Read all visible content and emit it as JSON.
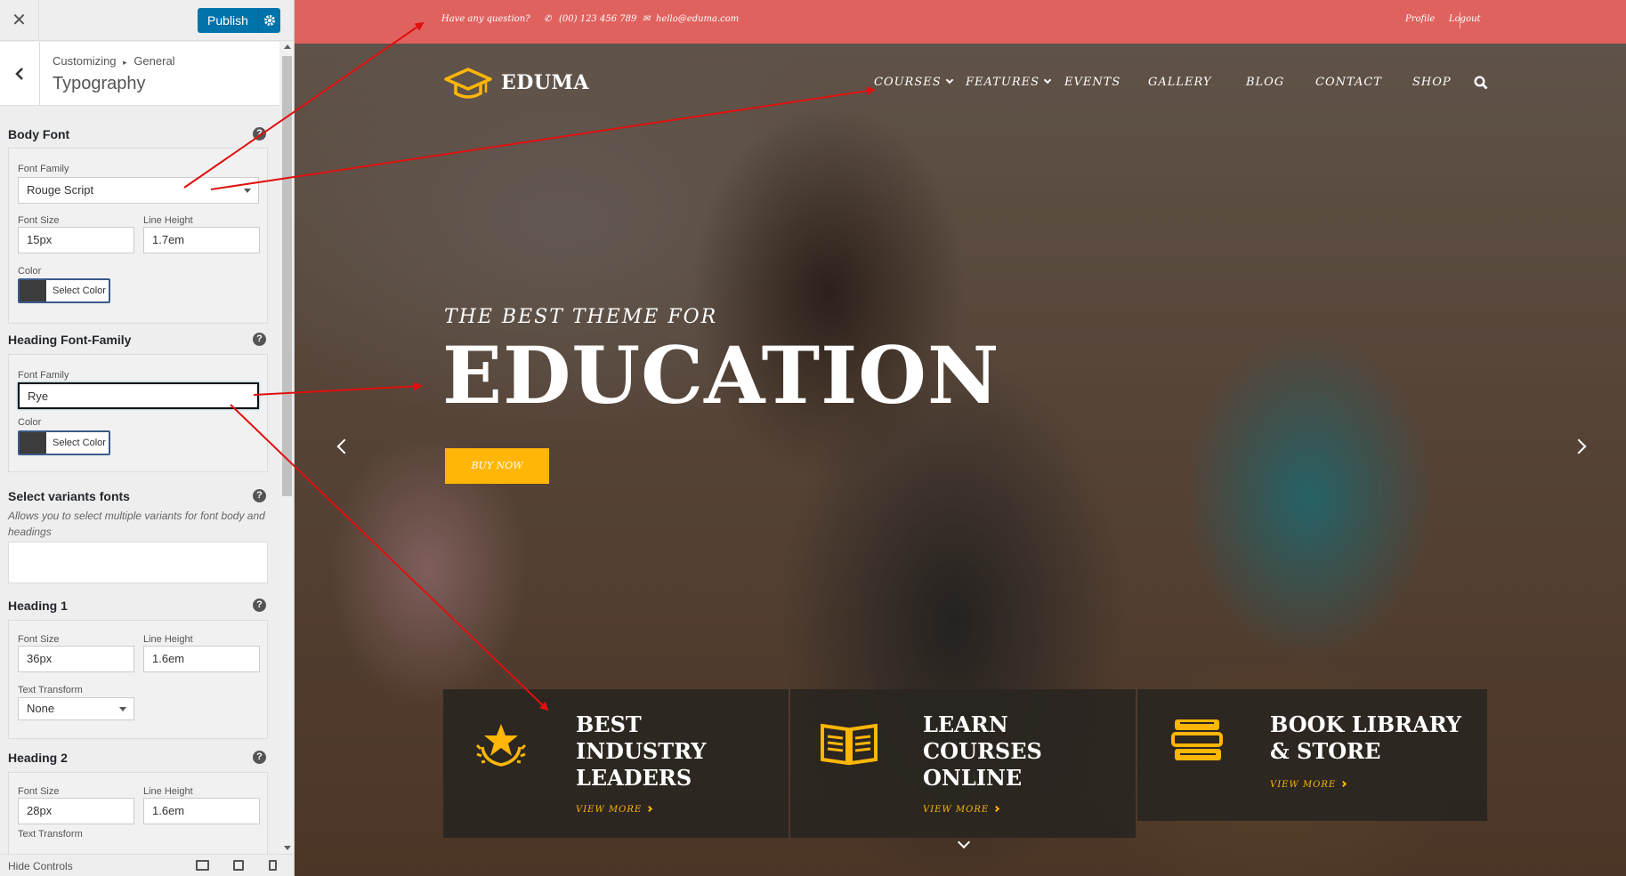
{
  "customizer": {
    "close_icon": "close-icon",
    "publish_label": "Publish",
    "crumbs": [
      "Customizing",
      "General"
    ],
    "crumb_separator": "▸",
    "section_title": "Typography",
    "body_font": {
      "title": "Body Font",
      "font_family_label": "Font Family",
      "font_family_value": "Rouge Script",
      "font_size_label": "Font Size",
      "font_size_value": "15px",
      "line_height_label": "Line Height",
      "line_height_value": "1.7em",
      "color_label": "Color",
      "color_button": "Select Color"
    },
    "heading_font": {
      "title": "Heading Font-Family",
      "font_family_label": "Font Family",
      "font_family_value": "Rye",
      "color_label": "Color",
      "color_button": "Select Color"
    },
    "variants": {
      "title": "Select variants fonts",
      "description": "Allows you to select multiple variants for font body and headings"
    },
    "heading1": {
      "title": "Heading 1",
      "font_size_label": "Font Size",
      "font_size_value": "36px",
      "line_height_label": "Line Height",
      "line_height_value": "1.6em",
      "text_transform_label": "Text Transform",
      "text_transform_value": "None"
    },
    "heading2": {
      "title": "Heading 2",
      "font_size_label": "Font Size",
      "font_size_value": "28px",
      "line_height_label": "Line Height",
      "line_height_value": "1.6em",
      "text_transform_label": "Text Transform"
    },
    "help_glyph": "?",
    "footer": {
      "hide_controls": "Hide Controls"
    }
  },
  "site": {
    "topbar": {
      "question": "Have any question?",
      "phone": "(00) 123 456 789",
      "email": "hello@eduma.com",
      "profile": "Profile",
      "logout": "Logout"
    },
    "logo": "EDUMA",
    "nav": [
      "COURSES",
      "FEATURES",
      "EVENTS",
      "GALLERY",
      "BLOG",
      "CONTACT",
      "SHOP"
    ],
    "hero": {
      "subtitle": "THE BEST THEME FOR",
      "title": "EDUCATION",
      "button": "BUY NOW"
    },
    "features": [
      {
        "icon": "medal-star-icon",
        "title_lines": [
          "BEST",
          "INDUSTRY",
          "LEADERS"
        ],
        "more": "VIEW MORE"
      },
      {
        "icon": "open-book-icon",
        "title_lines": [
          "LEARN",
          "COURSES",
          "ONLINE"
        ],
        "more": "VIEW MORE"
      },
      {
        "icon": "book-stack-icon",
        "title_lines": [
          "BOOK LIBRARY",
          "& STORE"
        ],
        "more": "VIEW MORE"
      }
    ]
  },
  "colors": {
    "topbar": "#e0625f",
    "accent": "#ffb606",
    "publish": "#0073aa",
    "annotation_arrow": "#e01010"
  }
}
